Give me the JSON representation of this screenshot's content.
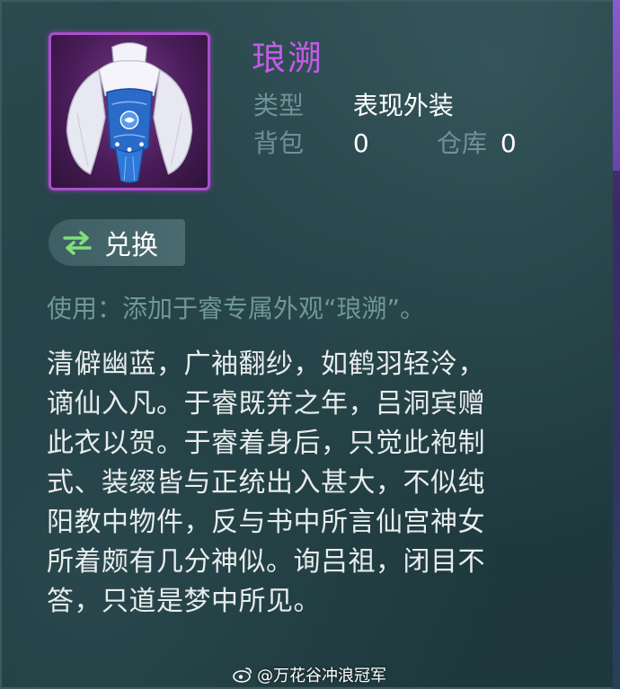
{
  "item": {
    "name": "琅溯",
    "type_label": "类型",
    "type_value": "表现外装",
    "bag_label": "背包",
    "bag_value": "0",
    "warehouse_label": "仓库",
    "warehouse_value": "0",
    "icon": "costume-icon"
  },
  "actions": {
    "exchange_label": "兑换",
    "exchange_icon": "swap-arrows-icon"
  },
  "usage_text": "使用：添加于睿专属外观“琅溯”。",
  "description_lines": [
    "清僻幽蓝，广袖翻纱，如鹤羽轻泠，",
    "谪仙入凡。于睿既笄之年，吕洞宾赠",
    "此衣以贺。于睿着身后，只觉此袍制",
    "式、装缀皆与正统出入甚大，不似纯",
    "阳教中物件，反与书中所言仙宫神女",
    "所着颇有几分神似。询吕祖，闭目不",
    "答，只道是梦中所见。"
  ],
  "watermark": "@万花谷冲浪冠军",
  "colors": {
    "name": "#c45ae8",
    "label": "#6f9296",
    "value": "#ffffff",
    "usage": "#6f9898",
    "description": "#e8ecec",
    "icon_border": "#b04ad0",
    "exchange_arrow": "#7fe07a"
  }
}
